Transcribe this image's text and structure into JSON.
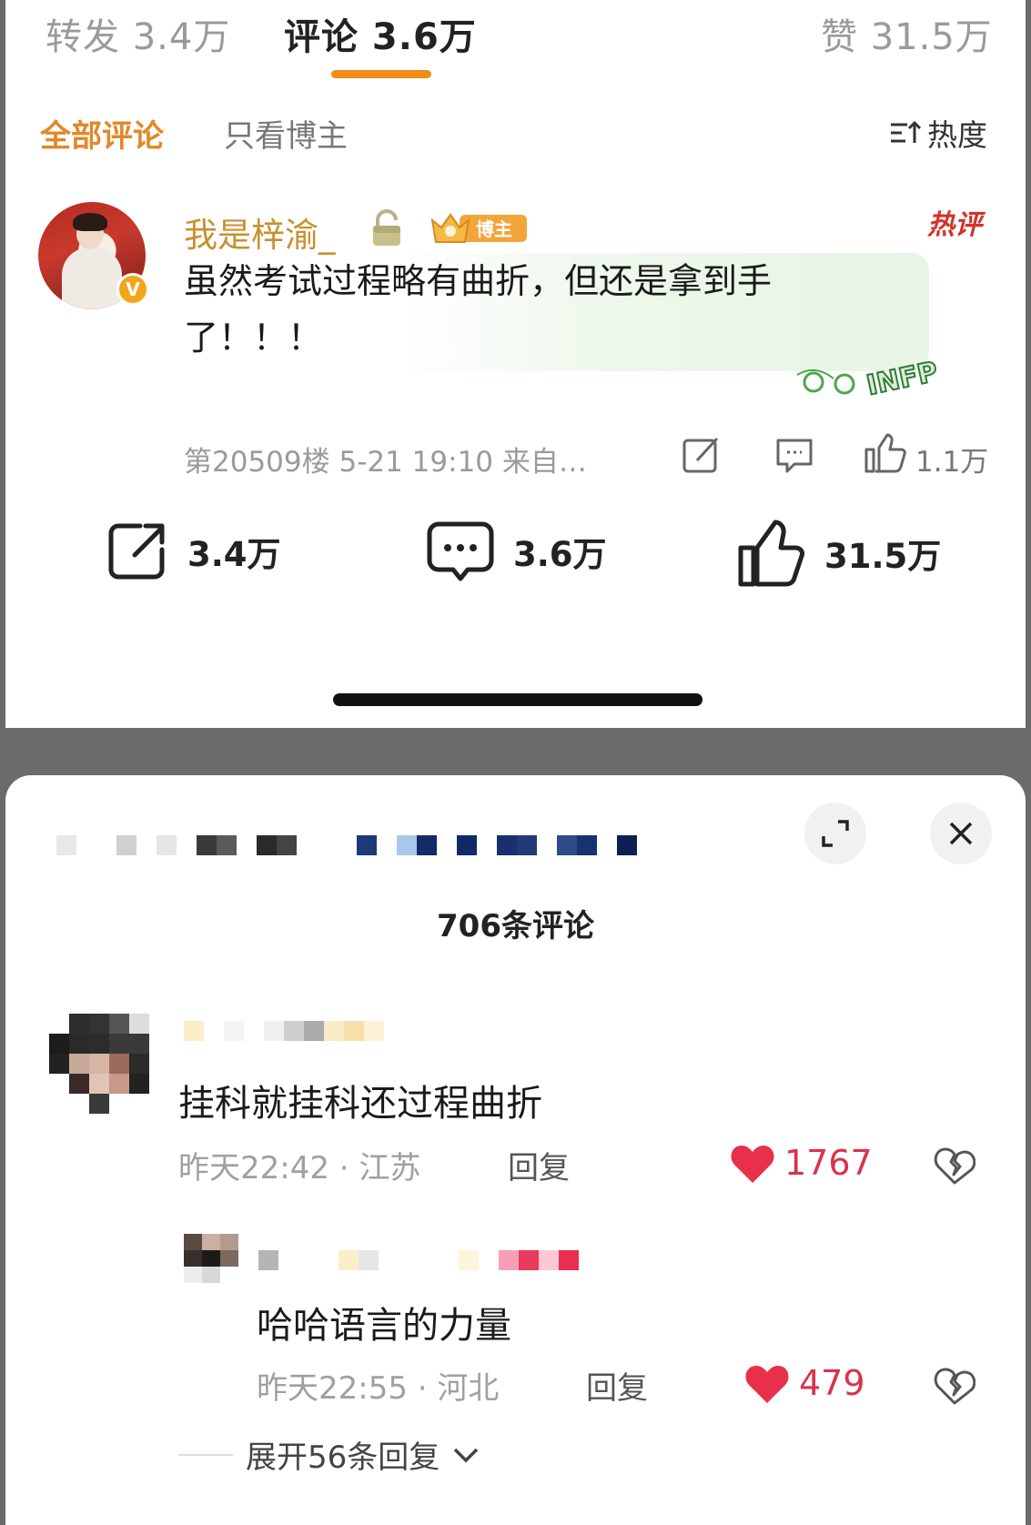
{
  "weibo": {
    "tabs": {
      "repost": "转发 3.4万",
      "comments": "评论 3.6万",
      "likes": "赞 31.5万"
    },
    "filters": {
      "all": "全部评论",
      "blogger_only": "只看博主",
      "sort": "热度"
    },
    "hot_comment": {
      "username": "我是梓渝_",
      "badge": "博主",
      "hot_tag": "热评",
      "text": "虽然考试过程略有曲折，但还是拿到手了！！！",
      "sticker_text": "INFP",
      "meta": "第20509楼 5-21 19:10 来自…",
      "like_count": "1.1万"
    },
    "post_stats": {
      "reposts": "3.4万",
      "comments": "3.6万",
      "likes": "31.5万"
    }
  },
  "douyin": {
    "comment_count": "706条评论",
    "comments": [
      {
        "text": "挂科就挂科还过程曲折",
        "meta": "昨天22:42 · 江苏",
        "reply_label": "回复",
        "likes": "1767"
      },
      {
        "text": "哈哈语言的力量",
        "meta": "昨天22:55 · 河北",
        "reply_label": "回复",
        "likes": "479"
      }
    ],
    "expand_label": "展开56条回复"
  },
  "colors": {
    "weibo_accent": "#f08c1a",
    "username_gold": "#c9902f",
    "hot_red": "#d4322a",
    "like_red": "#d9324a"
  },
  "icons": [
    "unlock-icon",
    "blogger-crown-icon",
    "sort-icon",
    "share-icon",
    "comment-icon",
    "thumbs-up-icon",
    "expand-icon",
    "close-icon",
    "heart-icon",
    "broken-heart-icon",
    "chevron-down-icon"
  ]
}
